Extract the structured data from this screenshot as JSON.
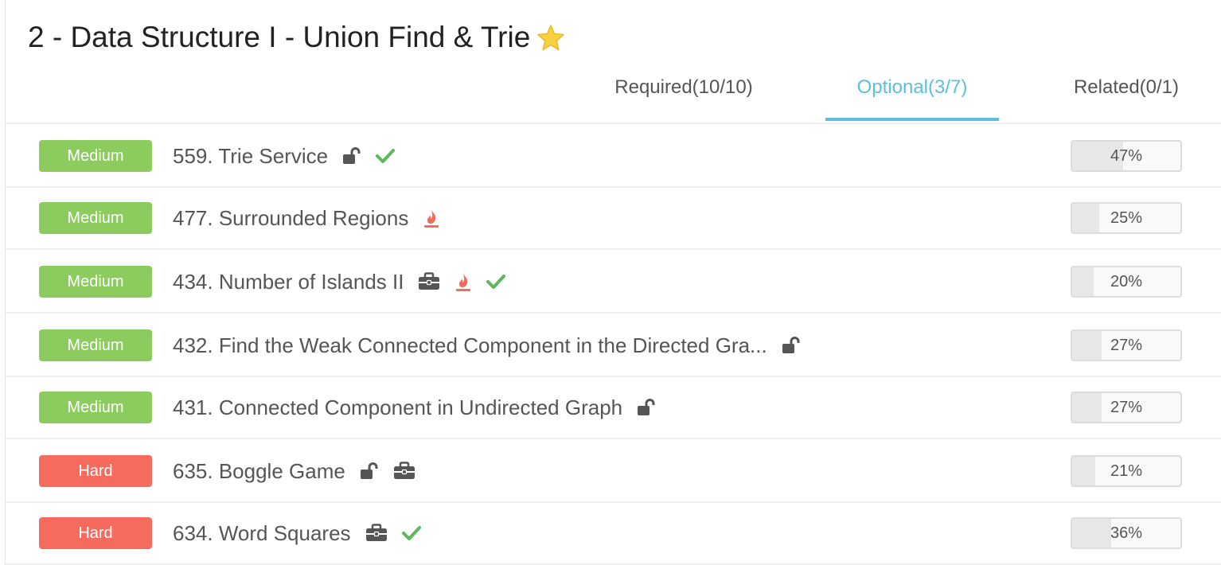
{
  "header": {
    "title": "2 - Data Structure I - Union Find & Trie",
    "star_icon": "star-icon"
  },
  "tabs": [
    {
      "label": "Required(10/10)",
      "active": false
    },
    {
      "label": "Optional(3/7)",
      "active": true
    },
    {
      "label": "Related(0/1)",
      "active": false
    }
  ],
  "colors": {
    "accent": "#5bc0de",
    "medium": "#8ccc5e",
    "hard": "#f76b5f",
    "check": "#5cb85c",
    "fire": "#f26b5b",
    "star": "#f7d23e"
  },
  "problems": [
    {
      "difficulty": "Medium",
      "title": "559. Trie Service",
      "icons": [
        "unlock-icon",
        "check-icon"
      ],
      "rate": "47%",
      "rate_value": 47
    },
    {
      "difficulty": "Medium",
      "title": "477. Surrounded Regions",
      "icons": [
        "fire-icon"
      ],
      "rate": "25%",
      "rate_value": 25
    },
    {
      "difficulty": "Medium",
      "title": "434. Number of Islands II",
      "icons": [
        "briefcase-icon",
        "fire-icon",
        "check-icon"
      ],
      "rate": "20%",
      "rate_value": 20
    },
    {
      "difficulty": "Medium",
      "title": "432. Find the Weak Connected Component in the Directed Gra...",
      "icons": [
        "unlock-icon"
      ],
      "rate": "27%",
      "rate_value": 27
    },
    {
      "difficulty": "Medium",
      "title": "431. Connected Component in Undirected Graph",
      "icons": [
        "unlock-icon"
      ],
      "rate": "27%",
      "rate_value": 27
    },
    {
      "difficulty": "Hard",
      "title": "635. Boggle Game",
      "icons": [
        "unlock-icon",
        "briefcase-icon"
      ],
      "rate": "21%",
      "rate_value": 21
    },
    {
      "difficulty": "Hard",
      "title": "634. Word Squares",
      "icons": [
        "briefcase-icon",
        "check-icon"
      ],
      "rate": "36%",
      "rate_value": 36
    }
  ]
}
